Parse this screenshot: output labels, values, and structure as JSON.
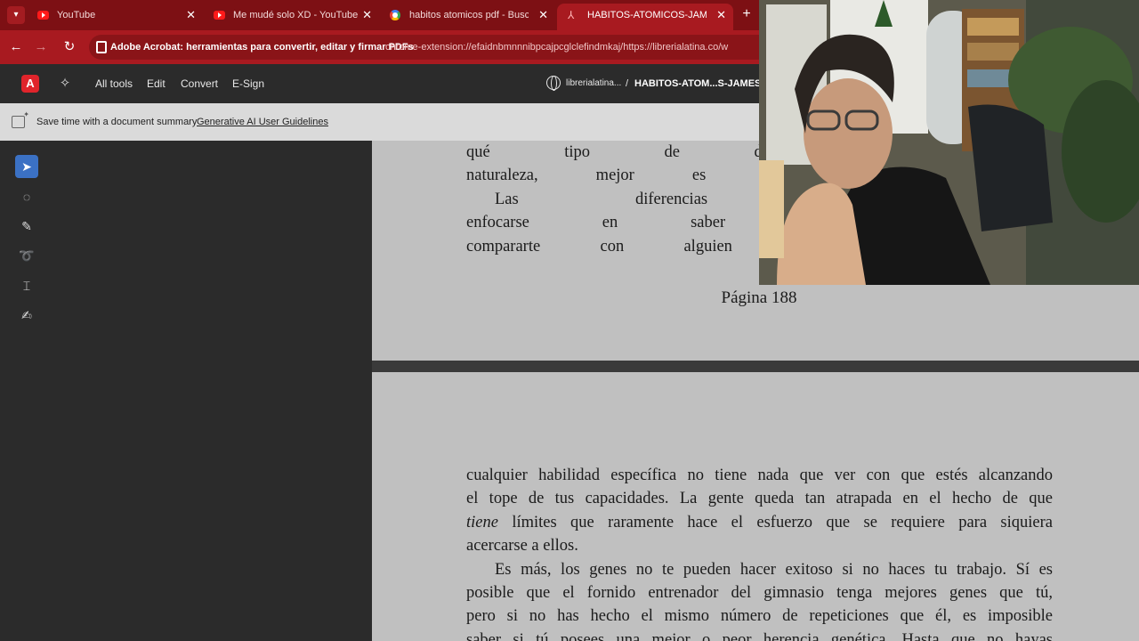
{
  "browser": {
    "tabs": [
      {
        "title": "YouTube",
        "favicon": "youtube-icon"
      },
      {
        "title": "Me mudé solo XD - YouTube",
        "favicon": "youtube-icon"
      },
      {
        "title": "habitos atomicos pdf - Buscar c",
        "favicon": "google-icon"
      },
      {
        "title": "HABITOS-ATOMICOS-JAMES-Cl",
        "favicon": "acrobat-pdf-icon",
        "active": true
      }
    ],
    "new_tab_symbol": "+",
    "site_name": "Adobe Acrobat: herramientas para convertir, editar y firmar PDFs",
    "url": "chrome-extension://efaidnbmnnnibpcajpcglclefindmkaj/https://librerialatina.co/w"
  },
  "acrobat": {
    "menu": {
      "all_tools": "All tools",
      "edit": "Edit",
      "convert": "Convert",
      "esign": "E-Sign"
    },
    "breadcrumb_site": "librerialatina...",
    "breadcrumb_separator": "/",
    "document_title": "HABITOS-ATOM...S-JAMES-C",
    "banner": {
      "text": "Save time with a document summary",
      "link": "Generative AI User Guidelines"
    },
    "tools": [
      "select-cursor-icon",
      "add-comment-icon",
      "highlight-pen-icon",
      "draw-freehand-icon",
      "select-text-icon",
      "fill-sign-icon"
    ]
  },
  "document": {
    "page1_lines": [
      "qué tipo de desafíos debemos evitar",
      "naturaleza, mejor es la estrategia que po",
      "Las diferencias biológicas import",
      "enfocarse en saber si estás alcanzand",
      "compararte con alguien más. El que te"
    ],
    "page_number": "Página 188",
    "page2_lines": [
      {
        "text": "cualquier habilidad específica no tiene nada que ver con que estés alcanzando"
      },
      {
        "text": "el tope de tus capacidades. La gente queda tan atrapada en el hecho de que"
      },
      {
        "em": "tiene",
        "text": " límites que raramente hace el esfuerzo que se requiere para siquiera"
      },
      {
        "text": "acercarse a ellos."
      },
      {
        "text": "Es más, los genes no te pueden hacer exitoso si no haces tu trabajo. Sí es"
      },
      {
        "text": "posible que el fornido entrenador del gimnasio tenga mejores genes que tú,"
      },
      {
        "text": "pero si no has hecho el mismo número de repeticiones que él, es imposible"
      },
      {
        "text": "saber si tú posees una mejor o peor herencia genética. Hasta que no hayas"
      }
    ]
  },
  "colors": {
    "browser_frame": "#a81a20",
    "acrobat_bar": "#2b2b2b",
    "page_background": "#c0c0c0",
    "active_tool": "#3b71c4"
  }
}
